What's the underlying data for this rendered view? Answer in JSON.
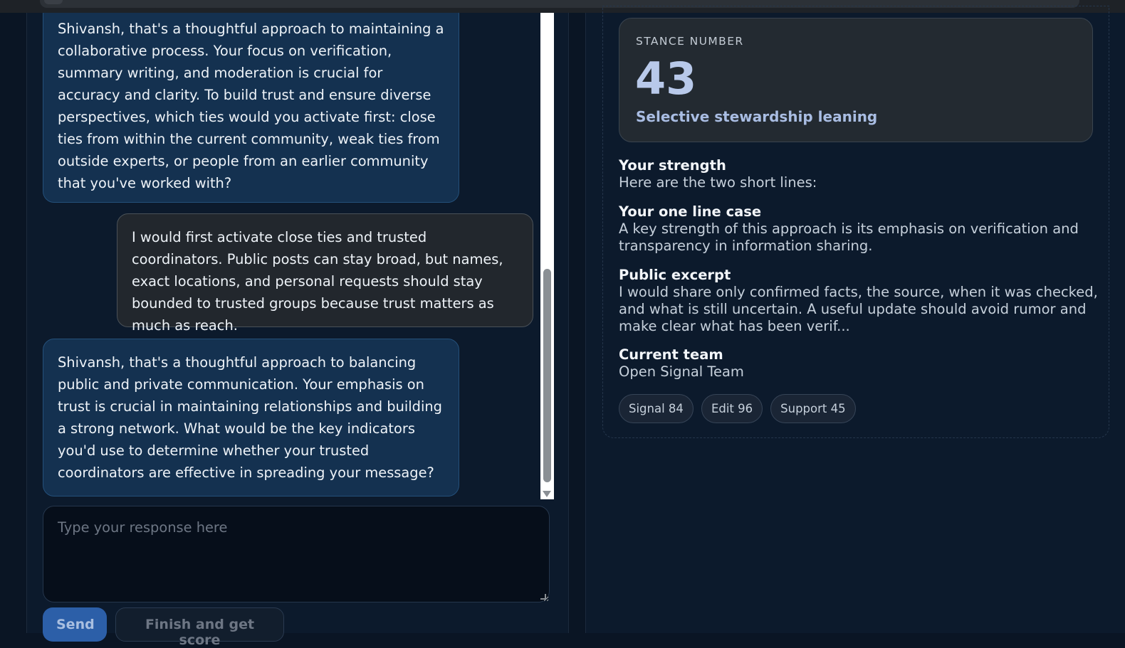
{
  "chat": {
    "messages": [
      {
        "role": "bot",
        "text": "Shivansh, that's a thoughtful approach to maintaining a collaborative process. Your focus on verification, summary writing, and moderation is crucial for accuracy and clarity. To build trust and ensure diverse perspectives, which ties would you activate first: close ties from within the current community, weak ties from outside experts, or people from an earlier community that you've worked with?"
      },
      {
        "role": "user",
        "text": "I would first activate close ties and trusted coordinators. Public posts can stay broad, but names, exact locations, and personal requests should stay bounded to trusted groups because trust matters as much as reach."
      },
      {
        "role": "bot",
        "text": "Shivansh, that's a thoughtful approach to balancing public and private communication. Your emphasis on trust is crucial in maintaining relationships and building a strong network. What would be the key indicators you'd use to determine whether your trusted coordinators are effective in spreading your message?"
      }
    ],
    "input_placeholder": "Type your response here",
    "input_value": "",
    "send_label": "Send",
    "finish_label": "Finish and get score"
  },
  "summary": {
    "stance_label": "STANCE NUMBER",
    "stance_number": "43",
    "stance_leaning": "Selective stewardship leaning",
    "strength_heading": "Your strength",
    "strength_text": "Here are the two short lines:",
    "case_heading": "Your one line case",
    "case_text": "A key strength of this approach is its emphasis on verification and transparency in information sharing.",
    "excerpt_heading": "Public excerpt",
    "excerpt_text": "I would share only confirmed facts, the source, when it was checked, and what is still uncertain. A useful update should avoid rumor and make clear what has been verif...",
    "team_heading": "Current team",
    "team_text": "Open Signal Team",
    "chips": [
      "Signal 84",
      "Edit 96",
      "Support 45"
    ]
  }
}
